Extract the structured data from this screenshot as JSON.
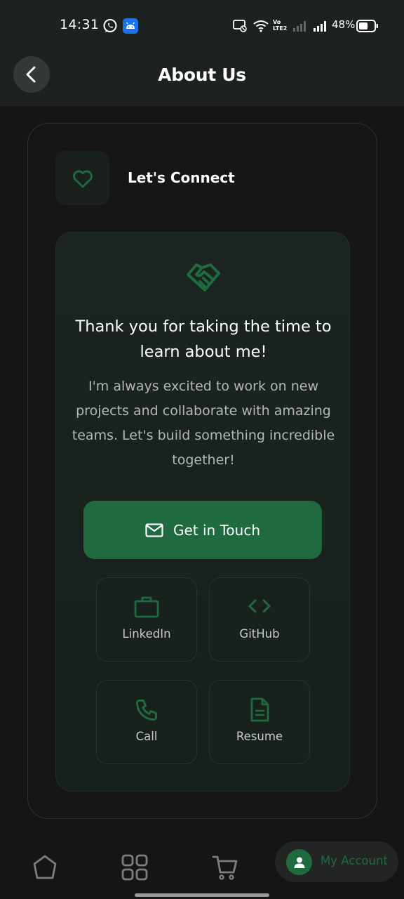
{
  "status_bar": {
    "time": "14:31",
    "network_label": "Vo LTE2",
    "battery_percent": "48%",
    "icons": [
      "whatsapp-icon",
      "android-icon",
      "cast-icon",
      "wifi-icon",
      "signal-icon",
      "battery-icon"
    ]
  },
  "app_bar": {
    "title": "About Us",
    "back_icon": "chevron-left-icon"
  },
  "connect": {
    "section_title": "Let's Connect",
    "section_icon": "heart-icon",
    "hero_icon": "handshake-icon",
    "headline": "Thank you for taking the time to learn about me!",
    "body": "I'm always excited to work on new projects and collaborate with amazing teams. Let's build something incredible together!",
    "cta_label": "Get in Touch",
    "cta_icon": "mail-icon",
    "links": [
      {
        "label": "LinkedIn",
        "icon": "briefcase-icon"
      },
      {
        "label": "GitHub",
        "icon": "code-icon"
      },
      {
        "label": "Call",
        "icon": "phone-icon"
      },
      {
        "label": "Resume",
        "icon": "document-icon"
      }
    ]
  },
  "bottom_nav": {
    "items": [
      {
        "icon": "home-icon"
      },
      {
        "icon": "grid-icon"
      },
      {
        "icon": "cart-icon"
      }
    ],
    "account_label": "My Account",
    "account_icon": "user-icon"
  },
  "colors": {
    "accent": "#1f6a3f",
    "background": "#151515",
    "app_bar": "#1e2121"
  }
}
